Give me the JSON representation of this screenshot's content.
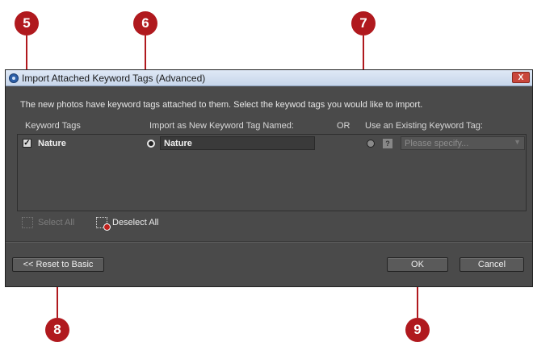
{
  "callouts": [
    "5",
    "6",
    "7",
    "8",
    "9"
  ],
  "dialog": {
    "title": "Import Attached Keyword Tags (Advanced)",
    "close_label": "X",
    "description": "The new photos have keyword tags attached to them.  Select the keywod tags you would like to import.",
    "columns": {
      "keyword_tags": "Keyword Tags",
      "import_new": "Import as New Keyword Tag Named:",
      "or": "OR",
      "use_existing": "Use an Existing Keyword Tag:"
    },
    "rows": [
      {
        "checked": true,
        "keyword": "Nature",
        "new_tag_name": "Nature",
        "existing_placeholder": "Please specify..."
      }
    ],
    "select_all": "Select All",
    "deselect_all": "Deselect All",
    "reset_button": "<< Reset to Basic",
    "ok_button": "OK",
    "cancel_button": "Cancel",
    "help_glyph": "?"
  },
  "colors": {
    "callout": "#b0191e",
    "dialog_bg": "#4a4a4a"
  }
}
